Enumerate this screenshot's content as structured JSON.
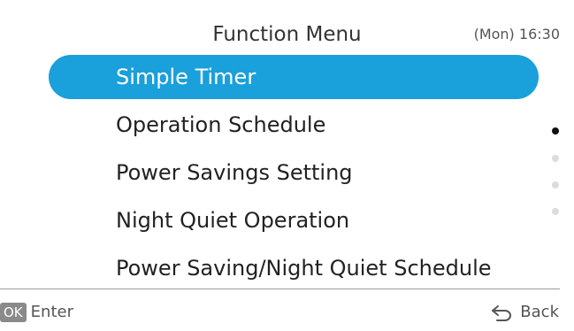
{
  "header": {
    "title": "Function Menu",
    "clock": "(Mon) 16:30"
  },
  "menu": {
    "items": [
      {
        "label": "Simple Timer",
        "selected": true
      },
      {
        "label": "Operation Schedule",
        "selected": false
      },
      {
        "label": "Power Savings Setting",
        "selected": false
      },
      {
        "label": "Night Quiet Operation",
        "selected": false
      },
      {
        "label": "Power Saving/Night Quiet Schedule",
        "selected": false
      }
    ]
  },
  "scroll": {
    "pages": 4,
    "current_page": 1
  },
  "footer": {
    "ok_badge": "OK",
    "enter_label": "Enter",
    "back_label": "Back",
    "back_icon": "back-arrow-icon"
  },
  "colors": {
    "accent": "#1aa0da",
    "divider": "#999999",
    "badge": "#8a8a8a"
  }
}
